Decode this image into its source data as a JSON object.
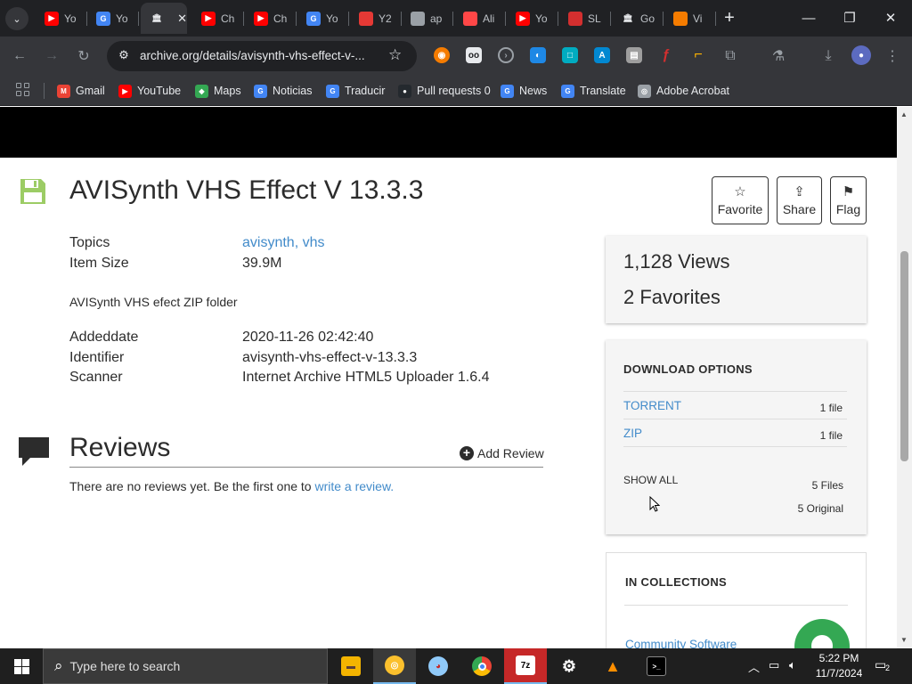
{
  "browser": {
    "tabs": [
      {
        "label": "Yo",
        "icon": "youtube-favicon",
        "color": "#ff0000"
      },
      {
        "label": "Yo",
        "icon": "google-favicon",
        "color": "#4285f4"
      },
      {
        "label": "",
        "icon": "archive-favicon",
        "color": "#e8eaed",
        "active": true
      },
      {
        "label": "Ch",
        "icon": "youtube-favicon",
        "color": "#ff0000"
      },
      {
        "label": "Ch",
        "icon": "youtube-favicon",
        "color": "#ff0000"
      },
      {
        "label": "Yo",
        "icon": "google-favicon",
        "color": "#4285f4"
      },
      {
        "label": "Y2",
        "icon": "download-favicon",
        "color": "#e53935"
      },
      {
        "label": "ap",
        "icon": "globe-favicon",
        "color": "#9aa0a6"
      },
      {
        "label": "Ali",
        "icon": "aliexpress-favicon",
        "color": "#ff4747"
      },
      {
        "label": "Yo",
        "icon": "youtube-favicon",
        "color": "#ff0000"
      },
      {
        "label": "SL",
        "icon": "sl-favicon",
        "color": "#d32f2f"
      },
      {
        "label": "Go",
        "icon": "archive-favicon",
        "color": "#e8eaed"
      },
      {
        "label": "Vi",
        "icon": "vi-favicon",
        "color": "#f57c00"
      }
    ],
    "new_tab": "+",
    "window_controls": {
      "minimize": "—",
      "restore": "❐",
      "close": "✕"
    },
    "url": "archive.org/details/avisynth-vhs-effect-v-...",
    "bookmarks": [
      {
        "label": "Gmail",
        "icon": "gmail-icon",
        "color": "#ea4335",
        "glyph": "M"
      },
      {
        "label": "YouTube",
        "icon": "youtube-icon",
        "color": "#ff0000",
        "glyph": "▶"
      },
      {
        "label": "Maps",
        "icon": "maps-icon",
        "color": "#34a853",
        "glyph": "◆"
      },
      {
        "label": "Noticias",
        "icon": "google-news-icon",
        "color": "#4285f4",
        "glyph": "G"
      },
      {
        "label": "Traducir",
        "icon": "translate-icon",
        "color": "#4285f4",
        "glyph": "G"
      },
      {
        "label": "Pull requests 0",
        "icon": "github-icon",
        "color": "#24292e",
        "glyph": "●"
      },
      {
        "label": "News",
        "icon": "google-news-icon",
        "color": "#4285f4",
        "glyph": "G"
      },
      {
        "label": "Translate",
        "icon": "translate-icon",
        "color": "#4285f4",
        "glyph": "G"
      },
      {
        "label": "Adobe Acrobat",
        "icon": "globe-icon",
        "color": "#9aa0a6",
        "glyph": "◎"
      }
    ]
  },
  "item": {
    "title": "AVISynth VHS Effect V 13.3.3",
    "actions": {
      "favorite": "Favorite",
      "share": "Share",
      "flag": "Flag"
    },
    "topics_label": "Topics",
    "topics_value": "avisynth, vhs",
    "size_label": "Item Size",
    "size_value": "39.9M",
    "description": "AVISynth VHS efect ZIP folder",
    "addeddate_label": "Addeddate",
    "addeddate_value": "2020-11-26 02:42:40",
    "identifier_label": "Identifier",
    "identifier_value": "avisynth-vhs-effect-v-13.3.3",
    "scanner_label": "Scanner",
    "scanner_value": "Internet Archive HTML5 Uploader 1.6.4"
  },
  "reviews": {
    "title": "Reviews",
    "add_review": "Add Review",
    "empty_text": "There are no reviews yet. Be the first one to ",
    "empty_link": "write a review."
  },
  "stats": {
    "views": "1,128 Views",
    "favorites": "2 Favorites"
  },
  "downloads": {
    "heading": "DOWNLOAD OPTIONS",
    "options": [
      {
        "name": "TORRENT",
        "count": "1 file"
      },
      {
        "name": "ZIP",
        "count": "1 file"
      }
    ],
    "show_all": "SHOW ALL",
    "files": "5 Files",
    "original": "5 Original"
  },
  "collections": {
    "heading": "IN COLLECTIONS",
    "item": "Community Software"
  },
  "taskbar": {
    "search_placeholder": "Type here to search",
    "time": "5:22 PM",
    "date": "11/7/2024",
    "notifications": "2"
  },
  "colors": {
    "link": "#428bca",
    "item_icon": "#9ccc65",
    "chrome_dark": "#202124"
  }
}
